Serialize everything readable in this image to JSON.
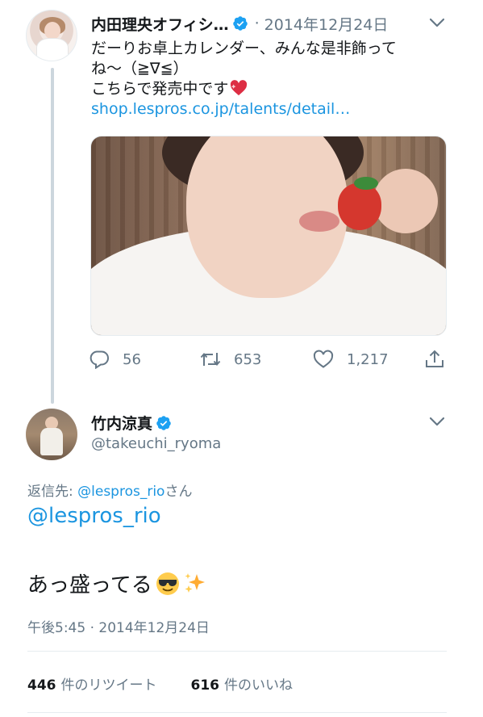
{
  "parent_tweet": {
    "display_name": "内田理央オフィシ…",
    "date": "2014年12月24日",
    "text_line1": "だーりお卓上カレンダー、みんな是非飾って",
    "text_line2": "ね〜（≧∇≦）",
    "text_line3": "こちらで発売中です",
    "link": "shop.lespros.co.jp/talents/detail…",
    "replies": "56",
    "retweets": "653",
    "likes": "1,217"
  },
  "focused_tweet": {
    "display_name": "竹内涼真",
    "handle": "@takeuchi_ryoma",
    "replying_prefix": "返信先: ",
    "replying_mention": "@lespros_rio",
    "replying_suffix": "さん",
    "mention": "@lespros_rio",
    "body": "あっ盛ってる",
    "timestamp": "午後5:45 · 2014年12月24日",
    "retweet_count": "446",
    "retweet_label": "件のリツイート",
    "like_count": "616",
    "like_label": "件のいいね"
  },
  "icons": {
    "verified": "verified-badge-icon",
    "chevron": "chevron-down-icon",
    "reply": "reply-icon",
    "retweet": "retweet-icon",
    "like": "heart-icon",
    "share": "share-icon",
    "emoji_heart": "sparkling-heart-emoji",
    "emoji_sunglasses": "sunglasses-face-emoji",
    "emoji_sparkles": "sparkles-emoji"
  },
  "colors": {
    "link": "#1b95e0",
    "secondary_text": "#657786",
    "primary_text": "#14171a",
    "divider": "#e6ecf0"
  }
}
